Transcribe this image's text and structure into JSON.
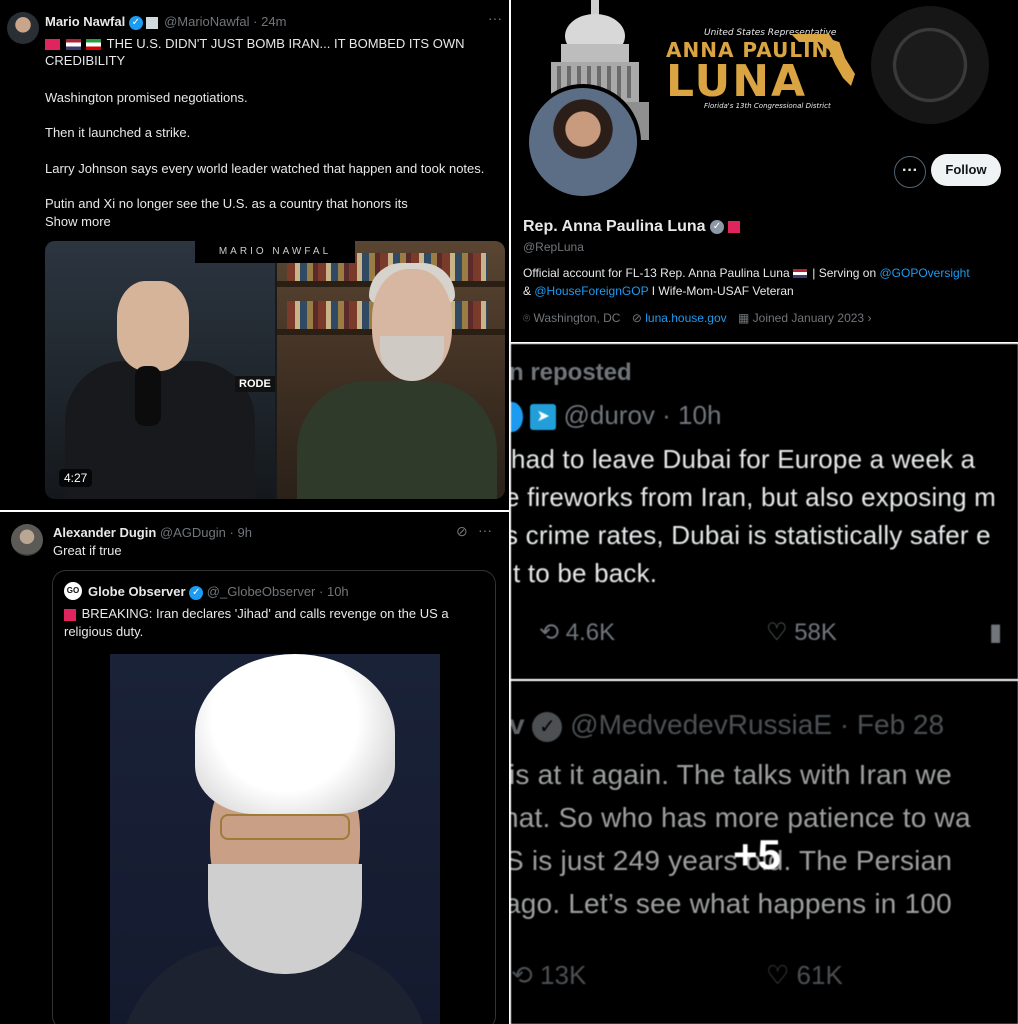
{
  "tweet1": {
    "author": "Mario Nawfal",
    "handle": "@MarioNawfal",
    "time": "24m",
    "line1": "THE U.S. DIDN'T JUST BOMB IRAN... IT BOMBED ITS OWN",
    "line2": "CREDIBILITY",
    "p2": "Washington promised negotiations.",
    "p3": "Then it launched a strike.",
    "p4": "Larry Johnson says every world leader watched that happen and took notes.",
    "p5": "Putin and Xi no longer see the U.S. as a country that honors its",
    "show_more": "Show more",
    "video_brand": "MARIO NAWFAL",
    "mic_brand": "RODE",
    "duration": "4:27",
    "more": "···"
  },
  "profile": {
    "banner_small": "United States Representative",
    "banner_name1": "ANNA PAULINA",
    "banner_name2": "LUNA",
    "banner_district": "Florida's 13th Congressional District",
    "more": "···",
    "follow": "Follow",
    "name": "Rep. Anna Paulina Luna",
    "handle": "@RepLuna",
    "bio1_a": "Official account for FL-13 Rep. Anna Paulina Luna",
    "bio1_b": " | Serving on ",
    "bio1_link": "@GOPOversight",
    "bio2_a": "& ",
    "bio2_link": "@HouseForeignGOP",
    "bio2_b": " I Wife-Mom-USAF Veteran",
    "location": "Washington, DC",
    "website": "luna.house.gov",
    "joined": "Joined January 2023"
  },
  "tweet3": {
    "author": "Alexander Dugin",
    "handle": "@AGDugin",
    "time": "9h",
    "text": "Great if true",
    "quoted_author": "Globe Observer",
    "quoted_handle": "@_GlobeObserver",
    "quoted_time": "10h",
    "quoted_logo": "GO",
    "quoted_line1": "BREAKING: Iran declares 'Jihad' and calls revenge on the US a",
    "quoted_line2": "religious duty.",
    "more": "···"
  },
  "tweet4": {
    "reposted": "n reposted",
    "handle": "@durov",
    "time": "10h",
    "l1": " had to leave Dubai for Europe a week a",
    "l2": "e fireworks from Iran, but also exposing m",
    "l3": "s crime rates, Dubai is statistically safer e",
    "l4": "it to be back.",
    "retweets": "4.6K",
    "likes": "58K"
  },
  "tweet5": {
    "name_part": "v",
    "handle": "@MedvedevRussiaE",
    "time": "Feb 28",
    "l1": "is at it again. The talks with Iran we",
    "l2": "hat. So who has more patience to wa",
    "l3": "S is just 249 years old. The Persian",
    "l4": "ago. Let’s see what happens in 100",
    "retweets": "13K",
    "likes": "61K",
    "overlay": "+5"
  }
}
